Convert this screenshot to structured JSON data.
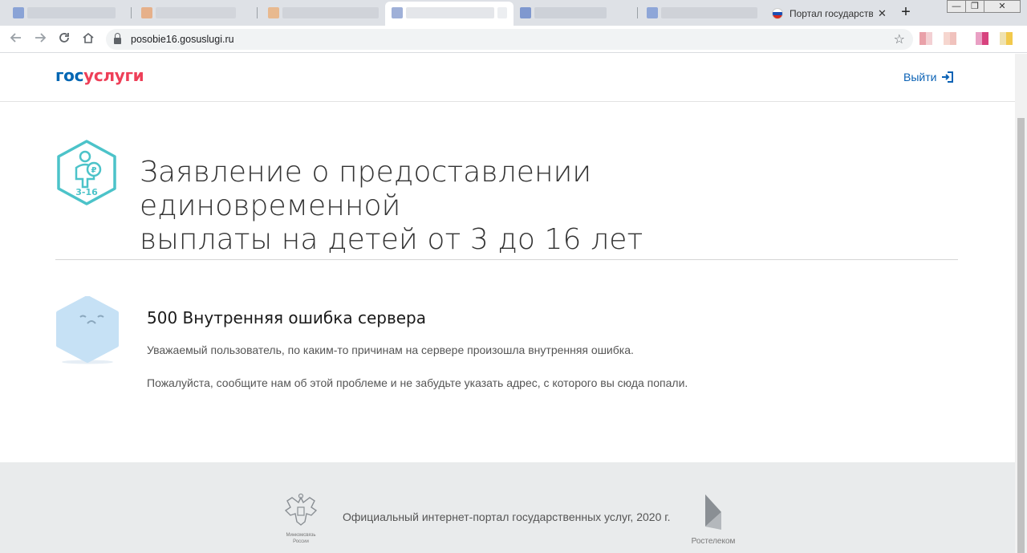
{
  "browser": {
    "tab_title": "Портал государств",
    "tab_close": "✕",
    "new_tab": "+",
    "url": "posobie16.gosuslugi.ru",
    "window_controls": [
      "—",
      "❐",
      "✕"
    ]
  },
  "header": {
    "logo_part1": "гос",
    "logo_part2": "услуги",
    "logout_label": "Выйти"
  },
  "service": {
    "icon_label": "3-16",
    "title_line1": "Заявление о предоставлении единовременной",
    "title_line2": "выплаты на детей от 3 до 16 лет"
  },
  "error": {
    "title": "500 Внутренняя ошибка сервера",
    "message1": "Уважаемый пользователь, по каким-то причинам на сервере произошла внутренняя ошибка.",
    "message2": "Пожалуйста, сообщите нам об этой проблеме и не забудьте указать адрес, с которого вы сюда попали."
  },
  "footer": {
    "ministry_line1": "Минкомсвязь",
    "ministry_line2": "России",
    "text": "Официальный интернет-портал государственных услуг, 2020 г.",
    "partner": "Ростелеком"
  },
  "colors": {
    "brand_blue": "#0066b3",
    "brand_red": "#ee3f58",
    "icon_teal": "#4cc3c9",
    "error_icon": "#c6e1f5"
  }
}
